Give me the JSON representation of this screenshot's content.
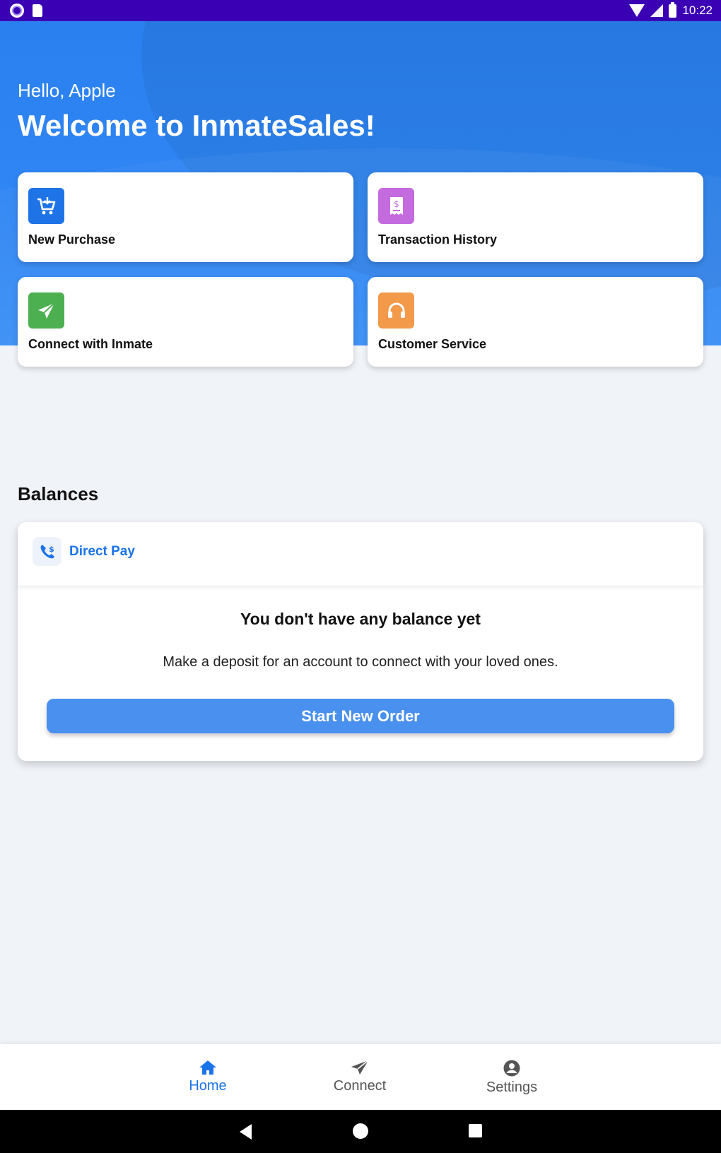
{
  "status_bar": {
    "time": "10:22"
  },
  "header": {
    "greeting": "Hello, Apple",
    "welcome": "Welcome to InmateSales!"
  },
  "actions": [
    {
      "label": "New Purchase",
      "icon": "cart-download-icon",
      "color": "#1e74e6"
    },
    {
      "label": "Transaction History",
      "icon": "receipt-dollar-icon",
      "color": "#c46be0"
    },
    {
      "label": "Connect with Inmate",
      "icon": "paper-plane-icon",
      "color": "#4caf50"
    },
    {
      "label": "Customer Service",
      "icon": "headset-icon",
      "color": "#f2994a"
    }
  ],
  "balances": {
    "title": "Balances",
    "account_label": "Direct Pay",
    "account_icon": "phone-dollar-icon",
    "empty_title": "You don't have any balance yet",
    "empty_message": "Make a deposit for an account to connect with your loved ones.",
    "cta_label": "Start New Order"
  },
  "bottom_nav": {
    "items": [
      {
        "label": "Home",
        "icon": "home-icon",
        "active": true
      },
      {
        "label": "Connect",
        "icon": "paper-plane-icon",
        "active": false
      },
      {
        "label": "Settings",
        "icon": "account-circle-icon",
        "active": false
      }
    ],
    "active_color": "#1b73e8",
    "inactive_color": "#555555"
  }
}
